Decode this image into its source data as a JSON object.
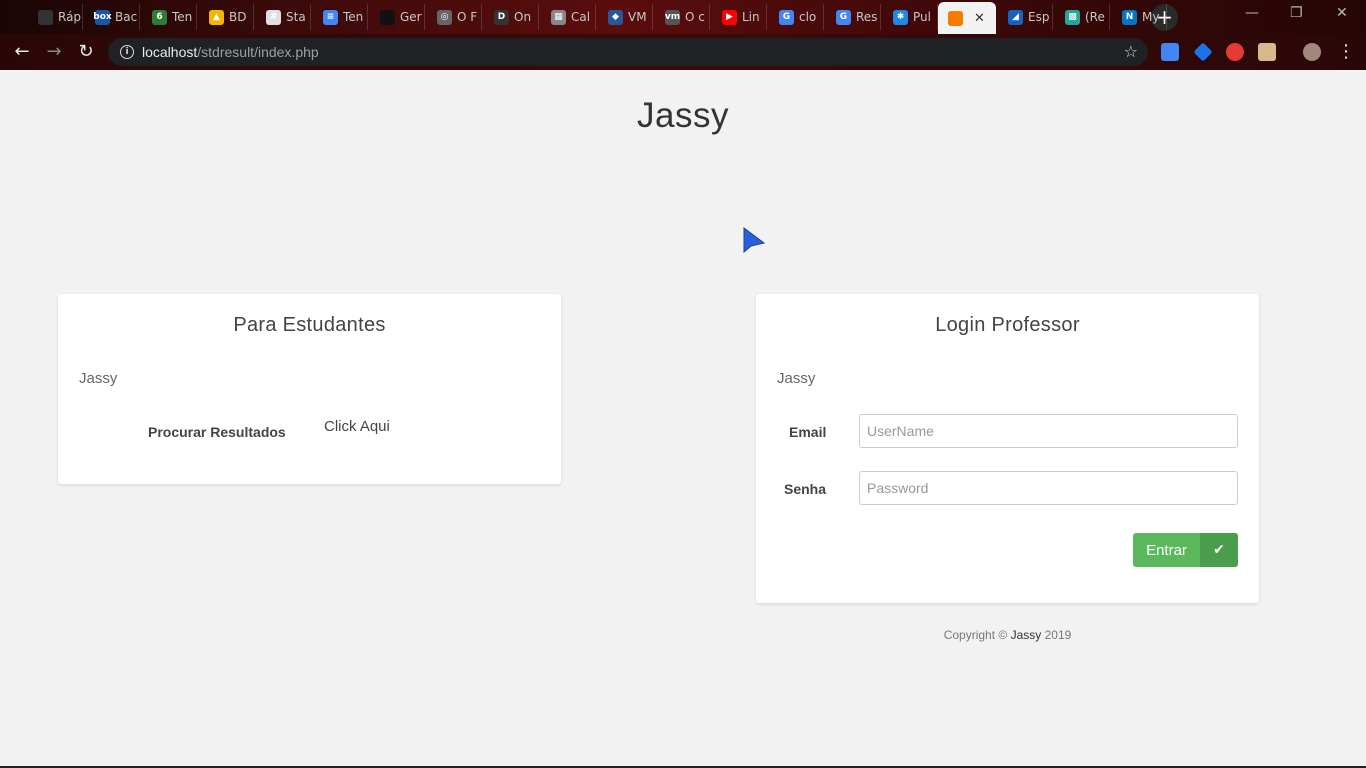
{
  "browser": {
    "tabs": [
      {
        "label": "Ráp",
        "color": "#333333",
        "glyph": ""
      },
      {
        "label": "Bac",
        "color": "#1a56a8",
        "glyph": "box"
      },
      {
        "label": "Ten",
        "color": "#2e7d32",
        "glyph": "6"
      },
      {
        "label": "BD",
        "color": "#f4b400",
        "glyph": "▲"
      },
      {
        "label": "Sta",
        "color": "#e0e0e0",
        "glyph": "#"
      },
      {
        "label": "Ten",
        "color": "#4285f4",
        "glyph": "≡"
      },
      {
        "label": "Ger",
        "color": "#111111",
        "glyph": ""
      },
      {
        "label": "O F",
        "color": "#666666",
        "glyph": "◎"
      },
      {
        "label": "On",
        "color": "#333333",
        "glyph": "D"
      },
      {
        "label": "Cal",
        "color": "#888888",
        "glyph": "▦"
      },
      {
        "label": "VM",
        "color": "#2b5797",
        "glyph": "◆"
      },
      {
        "label": "O c",
        "color": "#555555",
        "glyph": "vm"
      },
      {
        "label": "Lin",
        "color": "#ff0000",
        "glyph": "▶"
      },
      {
        "label": "clo",
        "color": "#4285f4",
        "glyph": "G"
      },
      {
        "label": "Res",
        "color": "#4285f4",
        "glyph": "G"
      },
      {
        "label": "Pul",
        "color": "#1e88e5",
        "glyph": "✱"
      }
    ],
    "active_tab": {
      "close": "✕",
      "color": "#f57c00"
    },
    "tabs_after": [
      {
        "label": "Esp",
        "color": "#1565c0",
        "glyph": "◢"
      },
      {
        "label": "(Re",
        "color": "#26a69a",
        "glyph": "▩"
      },
      {
        "label": "My",
        "color": "#0277bd",
        "glyph": "N"
      }
    ],
    "new_tab": "+",
    "url_host": "localhost",
    "url_path": "/stdresult/index.php"
  },
  "header": {
    "title": "Jassy"
  },
  "student_card": {
    "title": "Para Estudantes",
    "subtitle": "Jassy",
    "search_label": "Procurar Resultados",
    "click_link": "Click Aqui"
  },
  "login_card": {
    "title": "Login Professor",
    "subtitle": "Jassy",
    "email_label": "Email",
    "email_placeholder": "UserName",
    "password_label": "Senha",
    "password_placeholder": "Password",
    "submit_label": "Entrar",
    "submit_icon": "check-icon"
  },
  "footer": {
    "copyright": "Copyright ©",
    "brand": "Jassy",
    "year": "2019"
  },
  "colors": {
    "success": "#5cb85c",
    "background": "#f2f2f2"
  }
}
